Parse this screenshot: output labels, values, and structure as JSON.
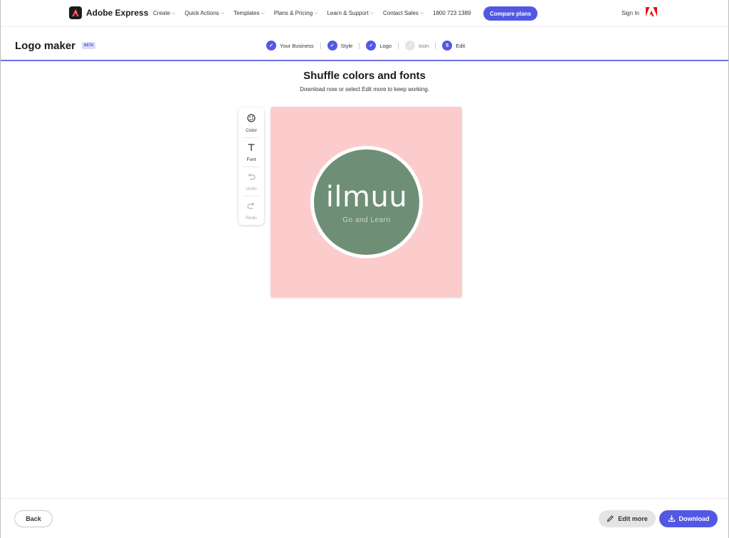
{
  "nav": {
    "brand": "Adobe Express",
    "links": [
      "Create",
      "Quick Actions",
      "Templates",
      "Plans & Pricing",
      "Learn & Support",
      "Contact Sales"
    ],
    "phone": "1800 723 1389",
    "compare_label": "Compare plans",
    "signin_label": "Sign In",
    "brand_icon": "adobe-express-icon",
    "adobe_icon": "adobe-icon"
  },
  "stepbar": {
    "title": "Logo maker",
    "badge": "BETA",
    "steps": [
      {
        "label": "Your Business",
        "state": "done"
      },
      {
        "label": "Style",
        "state": "done"
      },
      {
        "label": "Logo",
        "state": "done"
      },
      {
        "label": "Icon",
        "state": "pending"
      },
      {
        "label": "Edit",
        "state": "current",
        "number": "5"
      }
    ]
  },
  "main": {
    "headline": "Shuffle colors and fonts",
    "subline": "Download now or select Edit more to keep working."
  },
  "toolbar": {
    "color_label": "Color",
    "font_label": "Font",
    "undo_label": "Undo",
    "redo_label": "Redo"
  },
  "logo": {
    "name": "ilmuu",
    "tagline": "Go and Learn",
    "background_color": "#fccccc",
    "badge_color": "#6e8e76"
  },
  "footer": {
    "back_label": "Back",
    "edit_label": "Edit more",
    "download_label": "Download"
  },
  "colors": {
    "accent": "#5258e4"
  }
}
